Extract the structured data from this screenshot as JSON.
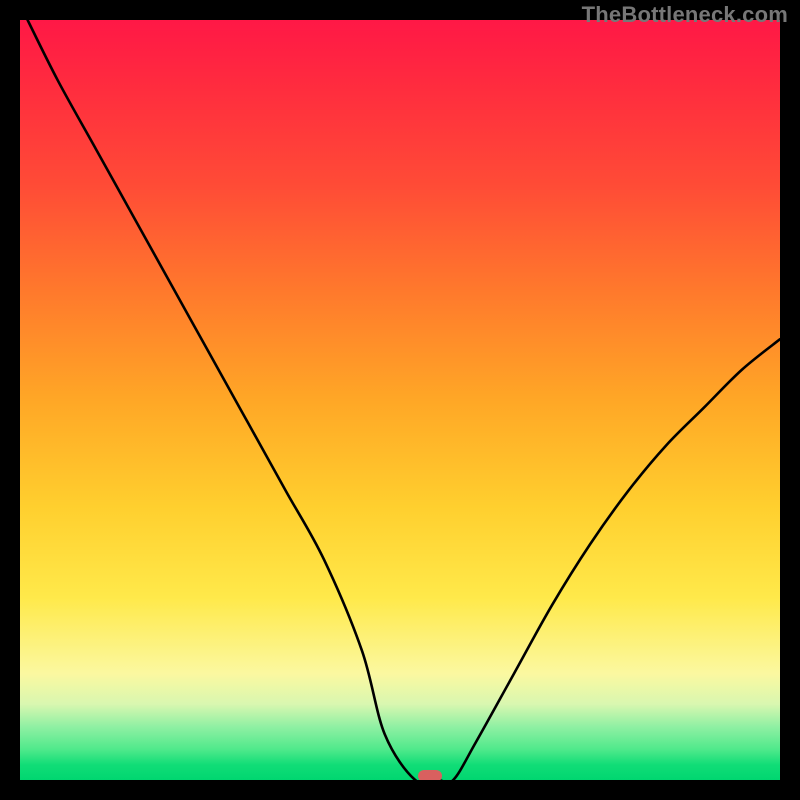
{
  "watermark": "TheBottleneck.com",
  "chart_data": {
    "type": "line",
    "title": "",
    "xlabel": "",
    "ylabel": "",
    "xlim": [
      0,
      100
    ],
    "ylim": [
      0,
      100
    ],
    "legend": false,
    "grid": false,
    "background": "red-to-green vertical gradient",
    "series": [
      {
        "name": "bottleneck-curve",
        "x": [
          1,
          5,
          10,
          15,
          20,
          25,
          30,
          35,
          40,
          45,
          48,
          52,
          55,
          57,
          60,
          65,
          70,
          75,
          80,
          85,
          90,
          95,
          100
        ],
        "y": [
          100,
          92,
          83,
          74,
          65,
          56,
          47,
          38,
          29,
          17,
          6,
          0,
          0,
          0,
          5,
          14,
          23,
          31,
          38,
          44,
          49,
          54,
          58
        ]
      }
    ],
    "annotations": [
      {
        "name": "optimal-marker",
        "x": 54,
        "y": 0,
        "shape": "pill",
        "color": "#d9605f"
      }
    ],
    "gradient_stops": [
      {
        "pos": 0.0,
        "color": "#ff1846"
      },
      {
        "pos": 0.22,
        "color": "#ff4c36"
      },
      {
        "pos": 0.5,
        "color": "#ffa726"
      },
      {
        "pos": 0.76,
        "color": "#ffe94a"
      },
      {
        "pos": 0.9,
        "color": "#d9f7b0"
      },
      {
        "pos": 1.0,
        "color": "#00d670"
      }
    ]
  }
}
